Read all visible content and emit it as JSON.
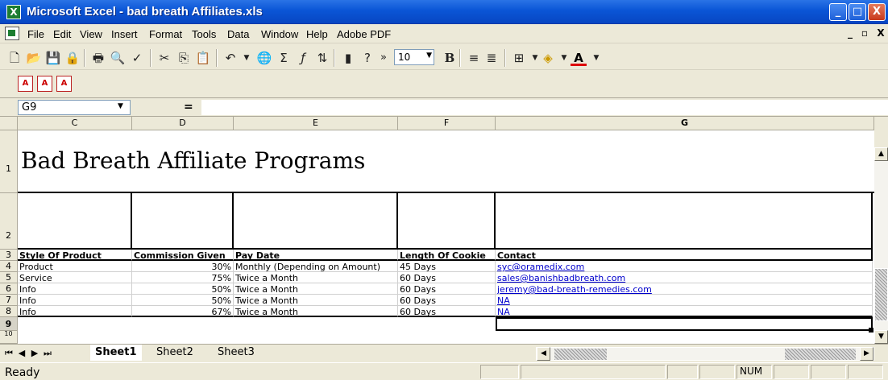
{
  "window": {
    "title": "Microsoft Excel - bad breath Affiliates.xls",
    "caption": {
      "minimize": "_",
      "maximize": "□",
      "close": "X"
    }
  },
  "menu": [
    "File",
    "Edit",
    "View",
    "Insert",
    "Format",
    "Tools",
    "Data",
    "Window",
    "Help",
    "Adobe PDF"
  ],
  "mdi": {
    "minimize": "_",
    "restore": "▫",
    "close": "X"
  },
  "toolbar": {
    "font_size": "10",
    "bold": "B",
    "font_color": "A",
    "more": "»"
  },
  "name_box": "G9",
  "formula_eq": "=",
  "columns": [
    "C",
    "D",
    "E",
    "F",
    "G"
  ],
  "rows": [
    "1",
    "2",
    "3",
    "4",
    "5",
    "6",
    "7",
    "8",
    "9",
    "10"
  ],
  "sheet": {
    "title": "Bad Breath Affiliate Programs",
    "headers": [
      "Style Of Product",
      "Commission Given",
      "Pay Date",
      "Length Of Cookie",
      "Contact"
    ],
    "data": [
      [
        "Product",
        "30%",
        "Monthly (Depending on Amount)",
        "45 Days",
        "syc@oramedix.com"
      ],
      [
        "Service",
        "75%",
        "Twice a Month",
        "60 Days",
        "sales@banishbadbreath.com"
      ],
      [
        "Info",
        "50%",
        "Twice a Month",
        "60 Days",
        "jeremy@bad-breath-remedies.com"
      ],
      [
        "Info",
        "50%",
        "Twice a Month",
        "60 Days",
        "NA"
      ],
      [
        "Info",
        "67%",
        "Twice a Month",
        "60 Days",
        "NA"
      ]
    ]
  },
  "tabs": [
    "Sheet1",
    "Sheet2",
    "Sheet3"
  ],
  "status": {
    "ready": "Ready",
    "num": "NUM"
  }
}
